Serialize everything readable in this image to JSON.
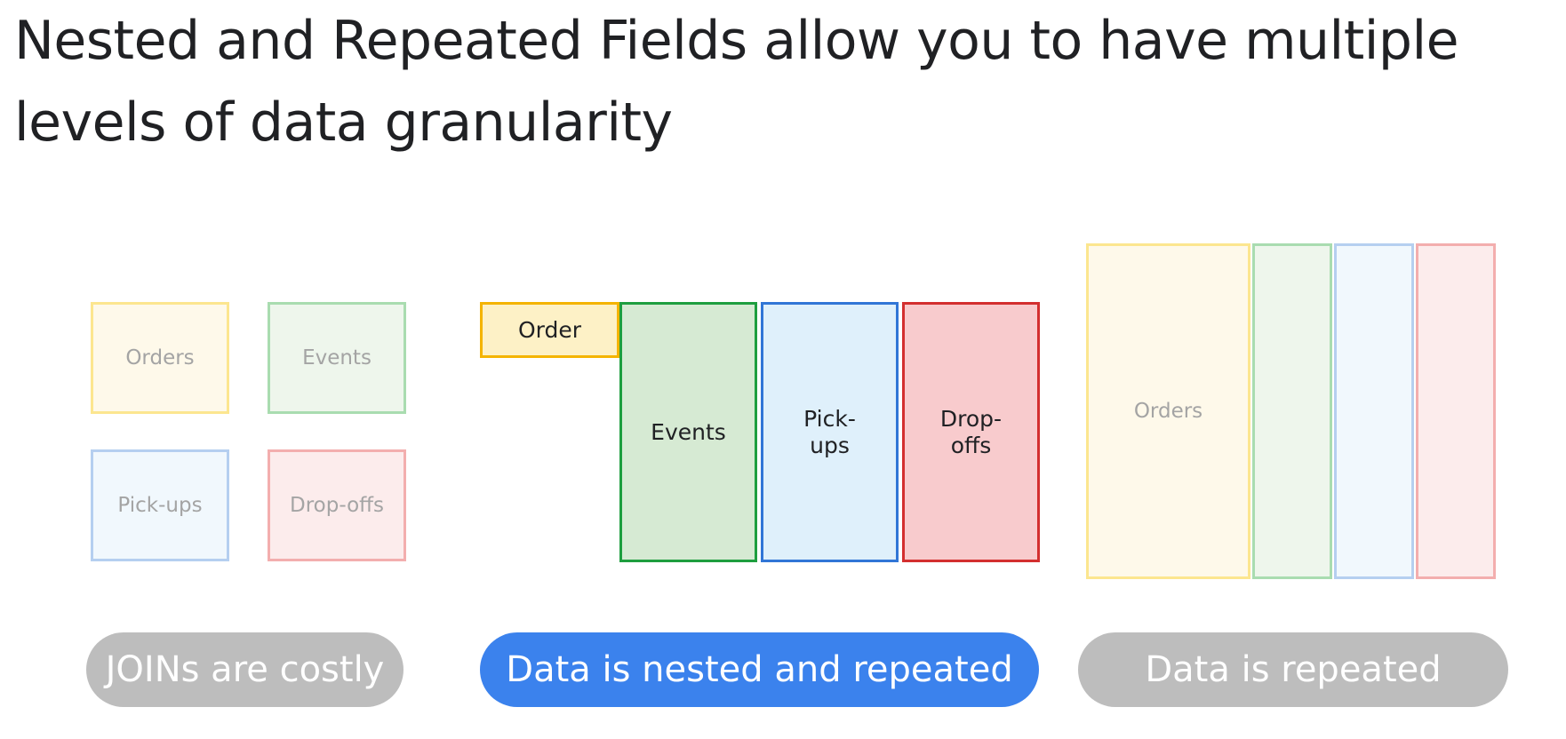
{
  "title": "Nested and Repeated Fields allow you to have multiple levels of data granularity",
  "left_panel": {
    "boxes": [
      "Orders",
      "Events",
      "Pick-ups",
      "Drop-offs"
    ],
    "caption": "JOINs are costly"
  },
  "middle_panel": {
    "order_label": "Order",
    "events_label": "Events",
    "pickups_label": "Pick-\nups",
    "dropoffs_label": "Drop-\noffs",
    "caption": "Data is nested and repeated"
  },
  "right_panel": {
    "orders_label": "Orders",
    "caption": "Data is repeated"
  },
  "colors": {
    "yellow": "#f4b400",
    "green": "#1e9e3f",
    "blue": "#3176d6",
    "red": "#d32f2f",
    "pill_active": "#3b82ed",
    "pill_inactive": "#bdbdbd"
  }
}
